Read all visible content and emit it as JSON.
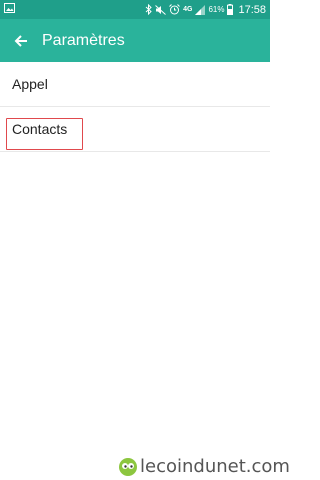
{
  "status_bar": {
    "network": "4G",
    "battery_percent": "61%",
    "time": "17:58",
    "icons": [
      "image-icon",
      "bluetooth-icon",
      "mute-icon",
      "alarm-icon",
      "lte-icon",
      "signal-icon",
      "battery-icon"
    ]
  },
  "app_bar": {
    "title": "Paramètres",
    "back_icon": "arrow-back-icon",
    "background_color": "#2ab39b"
  },
  "settings": {
    "items": [
      {
        "label": "Appel"
      },
      {
        "label": "Contacts"
      }
    ],
    "highlight_color": "#e0494d"
  },
  "watermark": {
    "text": "lecoindunet.com"
  }
}
